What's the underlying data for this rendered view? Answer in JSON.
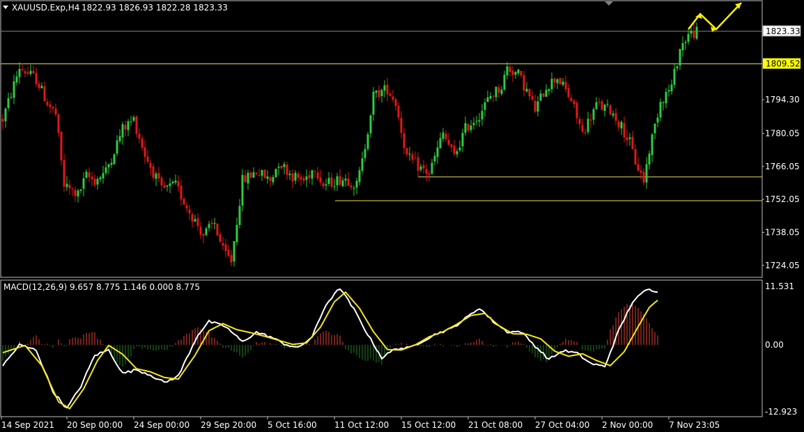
{
  "colors": {
    "background": "#000000",
    "bull": "#2ecc40",
    "bear": "#e01818",
    "level_line": "#e8e05a",
    "macd_line": "#ffffff",
    "signal_line": "#f5e61a",
    "hist_pos": "#c0392b",
    "hist_neg": "#1e6b1e",
    "frame": "#c0c0c0",
    "arrow": "#ffee00"
  },
  "header": {
    "symbol_label": "XAUUSD.Exp,H4",
    "ohlc": "1822.93 1826.93 1822.28 1823.33"
  },
  "macd_header": {
    "label": "MACD(12,26,9) 9.657 8.775 1.146 0.000 8.775"
  },
  "chart_data": [
    {
      "type": "candlestick",
      "symbol": "XAUUSD.Exp",
      "timeframe": "H4",
      "ylim": [
        1719,
        1836
      ],
      "y_ticks": [
        "1794.30",
        "1780.05",
        "1766.05",
        "1752.05",
        "1738.05",
        "1724.05"
      ],
      "current_price": "1823.33",
      "level_price": "1809.52",
      "horizontal_levels": [
        1823.33,
        1809.52,
        1761.6,
        1751.5
      ],
      "x_labels": [
        "14 Sep 2021",
        "20 Sep 00:00",
        "24 Sep 00:00",
        "29 Sep 20:00",
        "5 Oct 16:00",
        "11 Oct 12:00",
        "15 Oct 12:00",
        "21 Oct 08:00",
        "27 Oct 04:00",
        "2 Nov 00:00",
        "7 Nov 23:05"
      ],
      "price_path": [
        [
          0,
          1786
        ],
        [
          6,
          1808
        ],
        [
          12,
          1803
        ],
        [
          16,
          1793
        ],
        [
          19,
          1788
        ],
        [
          22,
          1758
        ],
        [
          27,
          1754
        ],
        [
          30,
          1762
        ],
        [
          33,
          1760
        ],
        [
          37,
          1764
        ],
        [
          43,
          1782
        ],
        [
          47,
          1786
        ],
        [
          51,
          1771
        ],
        [
          57,
          1756
        ],
        [
          62,
          1758
        ],
        [
          66,
          1749
        ],
        [
          72,
          1737
        ],
        [
          76,
          1742
        ],
        [
          79,
          1730
        ],
        [
          82,
          1726
        ],
        [
          86,
          1760
        ],
        [
          91,
          1764
        ],
        [
          96,
          1760
        ],
        [
          99,
          1768
        ],
        [
          104,
          1762
        ],
        [
          108,
          1760
        ],
        [
          112,
          1766
        ],
        [
          115,
          1758
        ],
        [
          119,
          1760
        ],
        [
          123,
          1761
        ],
        [
          127,
          1758
        ],
        [
          129,
          1768
        ],
        [
          133,
          1796
        ],
        [
          138,
          1799
        ],
        [
          141,
          1793
        ],
        [
          145,
          1770
        ],
        [
          149,
          1766
        ],
        [
          153,
          1763
        ],
        [
          158,
          1780
        ],
        [
          162,
          1770
        ],
        [
          166,
          1782
        ],
        [
          171,
          1788
        ],
        [
          175,
          1796
        ],
        [
          179,
          1800
        ],
        [
          181,
          1808
        ],
        [
          185,
          1805
        ],
        [
          188,
          1798
        ],
        [
          191,
          1790
        ],
        [
          195,
          1800
        ],
        [
          199,
          1804
        ],
        [
          204,
          1794
        ],
        [
          208,
          1780
        ],
        [
          213,
          1792
        ],
        [
          218,
          1790
        ],
        [
          222,
          1783
        ],
        [
          225,
          1776
        ],
        [
          227,
          1768
        ],
        [
          230,
          1760
        ],
        [
          232,
          1773
        ],
        [
          236,
          1794
        ],
        [
          240,
          1800
        ],
        [
          243,
          1816
        ],
        [
          246,
          1822
        ],
        [
          249,
          1823
        ]
      ]
    },
    {
      "type": "line",
      "name": "MACD(12,26,9)",
      "ylim": [
        -12.923,
        11.531
      ],
      "y_ticks": [
        "11.531",
        "0.00",
        "-12.923"
      ],
      "macd_path": [
        [
          0,
          -4
        ],
        [
          6,
          0
        ],
        [
          12,
          -1
        ],
        [
          18,
          -9
        ],
        [
          23,
          -12.3
        ],
        [
          28,
          -8
        ],
        [
          33,
          -2
        ],
        [
          38,
          -1
        ],
        [
          43,
          -5.5
        ],
        [
          48,
          -4.8
        ],
        [
          53,
          -5.8
        ],
        [
          58,
          -7.3
        ],
        [
          63,
          -6
        ],
        [
          70,
          2
        ],
        [
          74,
          4.6
        ],
        [
          80,
          3.6
        ],
        [
          86,
          0.6
        ],
        [
          91,
          2.5
        ],
        [
          96,
          1.6
        ],
        [
          101,
          0.2
        ],
        [
          106,
          -0.6
        ],
        [
          111,
          1.6
        ],
        [
          116,
          8
        ],
        [
          121,
          11.2
        ],
        [
          126,
          7
        ],
        [
          131,
          2
        ],
        [
          136,
          -2.5
        ],
        [
          141,
          -0.7
        ],
        [
          146,
          -0.6
        ],
        [
          151,
          0.9
        ],
        [
          156,
          2.3
        ],
        [
          161,
          3.2
        ],
        [
          166,
          5.2
        ],
        [
          171,
          7.3
        ],
        [
          176,
          4.6
        ],
        [
          181,
          2.6
        ],
        [
          186,
          2.6
        ],
        [
          191,
          -0.2
        ],
        [
          196,
          -2.8
        ],
        [
          201,
          -1.1
        ],
        [
          206,
          -1.6
        ],
        [
          211,
          -3.6
        ],
        [
          216,
          -4.2
        ],
        [
          221,
          2.8
        ],
        [
          226,
          8.5
        ],
        [
          231,
          10.9
        ],
        [
          235,
          10.6
        ]
      ],
      "signal_path": [
        [
          0,
          -1.5
        ],
        [
          8,
          -0.1
        ],
        [
          14,
          -4
        ],
        [
          20,
          -11
        ],
        [
          24,
          -12.3
        ],
        [
          29,
          -8.5
        ],
        [
          34,
          -3
        ],
        [
          38,
          -0.1
        ],
        [
          43,
          -1.8
        ],
        [
          48,
          -4.6
        ],
        [
          53,
          -5.2
        ],
        [
          58,
          -6.3
        ],
        [
          63,
          -6.6
        ],
        [
          69,
          -2
        ],
        [
          74,
          2.8
        ],
        [
          79,
          4.2
        ],
        [
          84,
          3
        ],
        [
          89,
          2.4
        ],
        [
          94,
          1.7
        ],
        [
          99,
          0.9
        ],
        [
          104,
          0.1
        ],
        [
          109,
          0.4
        ],
        [
          114,
          3.5
        ],
        [
          119,
          8.5
        ],
        [
          123,
          10.4
        ],
        [
          128,
          7.2
        ],
        [
          133,
          2.6
        ],
        [
          138,
          -0.9
        ],
        [
          143,
          -1
        ],
        [
          148,
          0
        ],
        [
          153,
          1.6
        ],
        [
          158,
          2.6
        ],
        [
          163,
          4.1
        ],
        [
          168,
          5.8
        ],
        [
          173,
          6.2
        ],
        [
          178,
          3.8
        ],
        [
          183,
          2.2
        ],
        [
          188,
          2.1
        ],
        [
          193,
          1.2
        ],
        [
          198,
          -1.2
        ],
        [
          203,
          -2.2
        ],
        [
          208,
          -1.7
        ],
        [
          213,
          -3
        ],
        [
          218,
          -4
        ],
        [
          223,
          -1.3
        ],
        [
          228,
          3.6
        ],
        [
          232,
          7.4
        ],
        [
          235,
          8.8
        ]
      ]
    }
  ]
}
